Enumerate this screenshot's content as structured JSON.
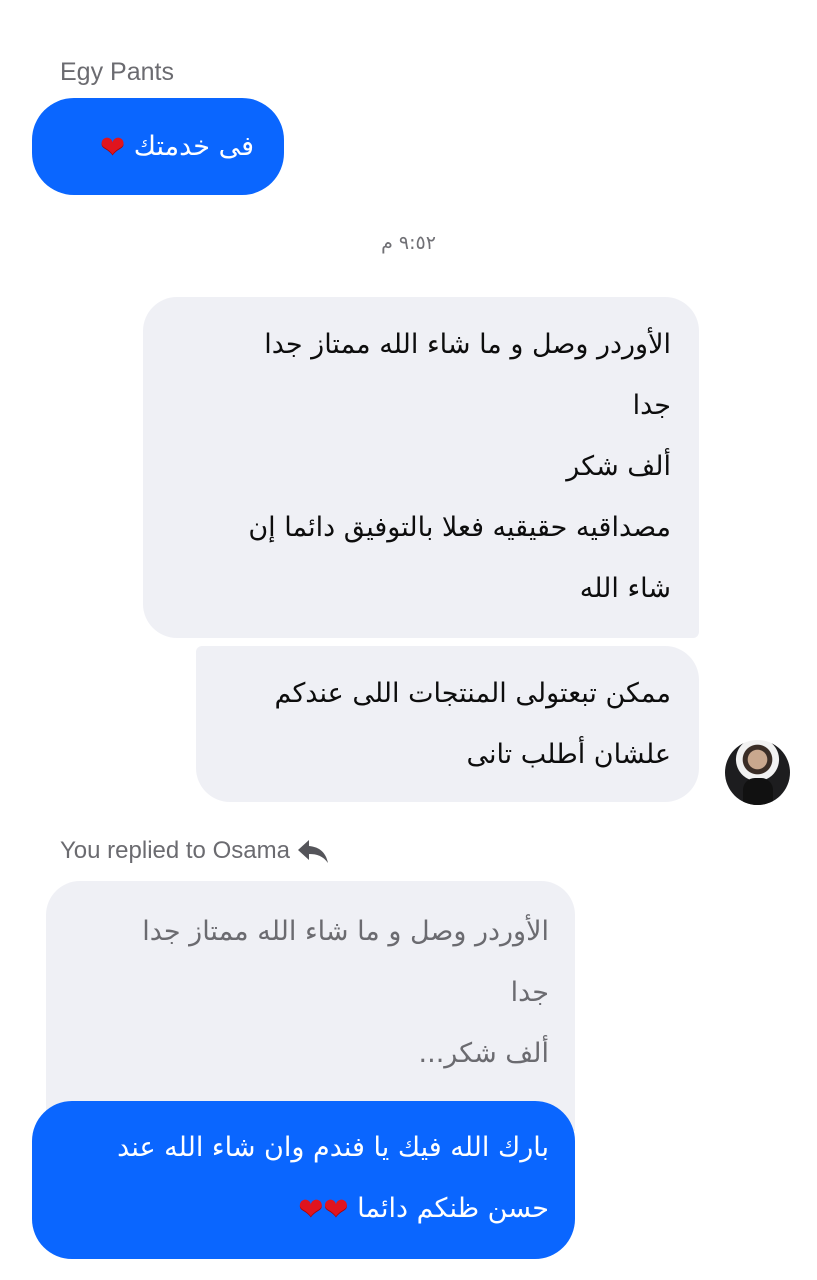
{
  "sender_name": "Egy Pants",
  "messages": {
    "m1": {
      "text": "فى خدمتك",
      "emoji": "❤"
    },
    "timestamp": "٩:٥٢ م",
    "m2": {
      "lines": [
        "الأوردر وصل و ما شاء الله ممتاز جدا",
        "جدا",
        "ألف شكر",
        "مصداقيه حقيقيه فعلا بالتوفيق دائما إن",
        "شاء الله"
      ]
    },
    "m3": {
      "lines": [
        "ممكن تبعتولى المنتجات اللى عندكم",
        "علشان أطلب تانى"
      ]
    },
    "reply_header": "You replied to Osama",
    "quoted": {
      "lines": [
        "الأوردر وصل و ما شاء الله ممتاز جدا",
        "جدا",
        "ألف شكر..."
      ]
    },
    "m4": {
      "lines": [
        "بارك الله فيك يا فندم وان شاء الله عند",
        "حسن ظنكم دائما"
      ],
      "emoji": "❤❤"
    }
  },
  "colors": {
    "outgoing_bubble": "#0a66ff",
    "incoming_bubble": "#eff0f5",
    "heart": "#e0141e"
  },
  "icons": {
    "reply": "reply-arrow-icon",
    "avatar": "user-avatar"
  }
}
